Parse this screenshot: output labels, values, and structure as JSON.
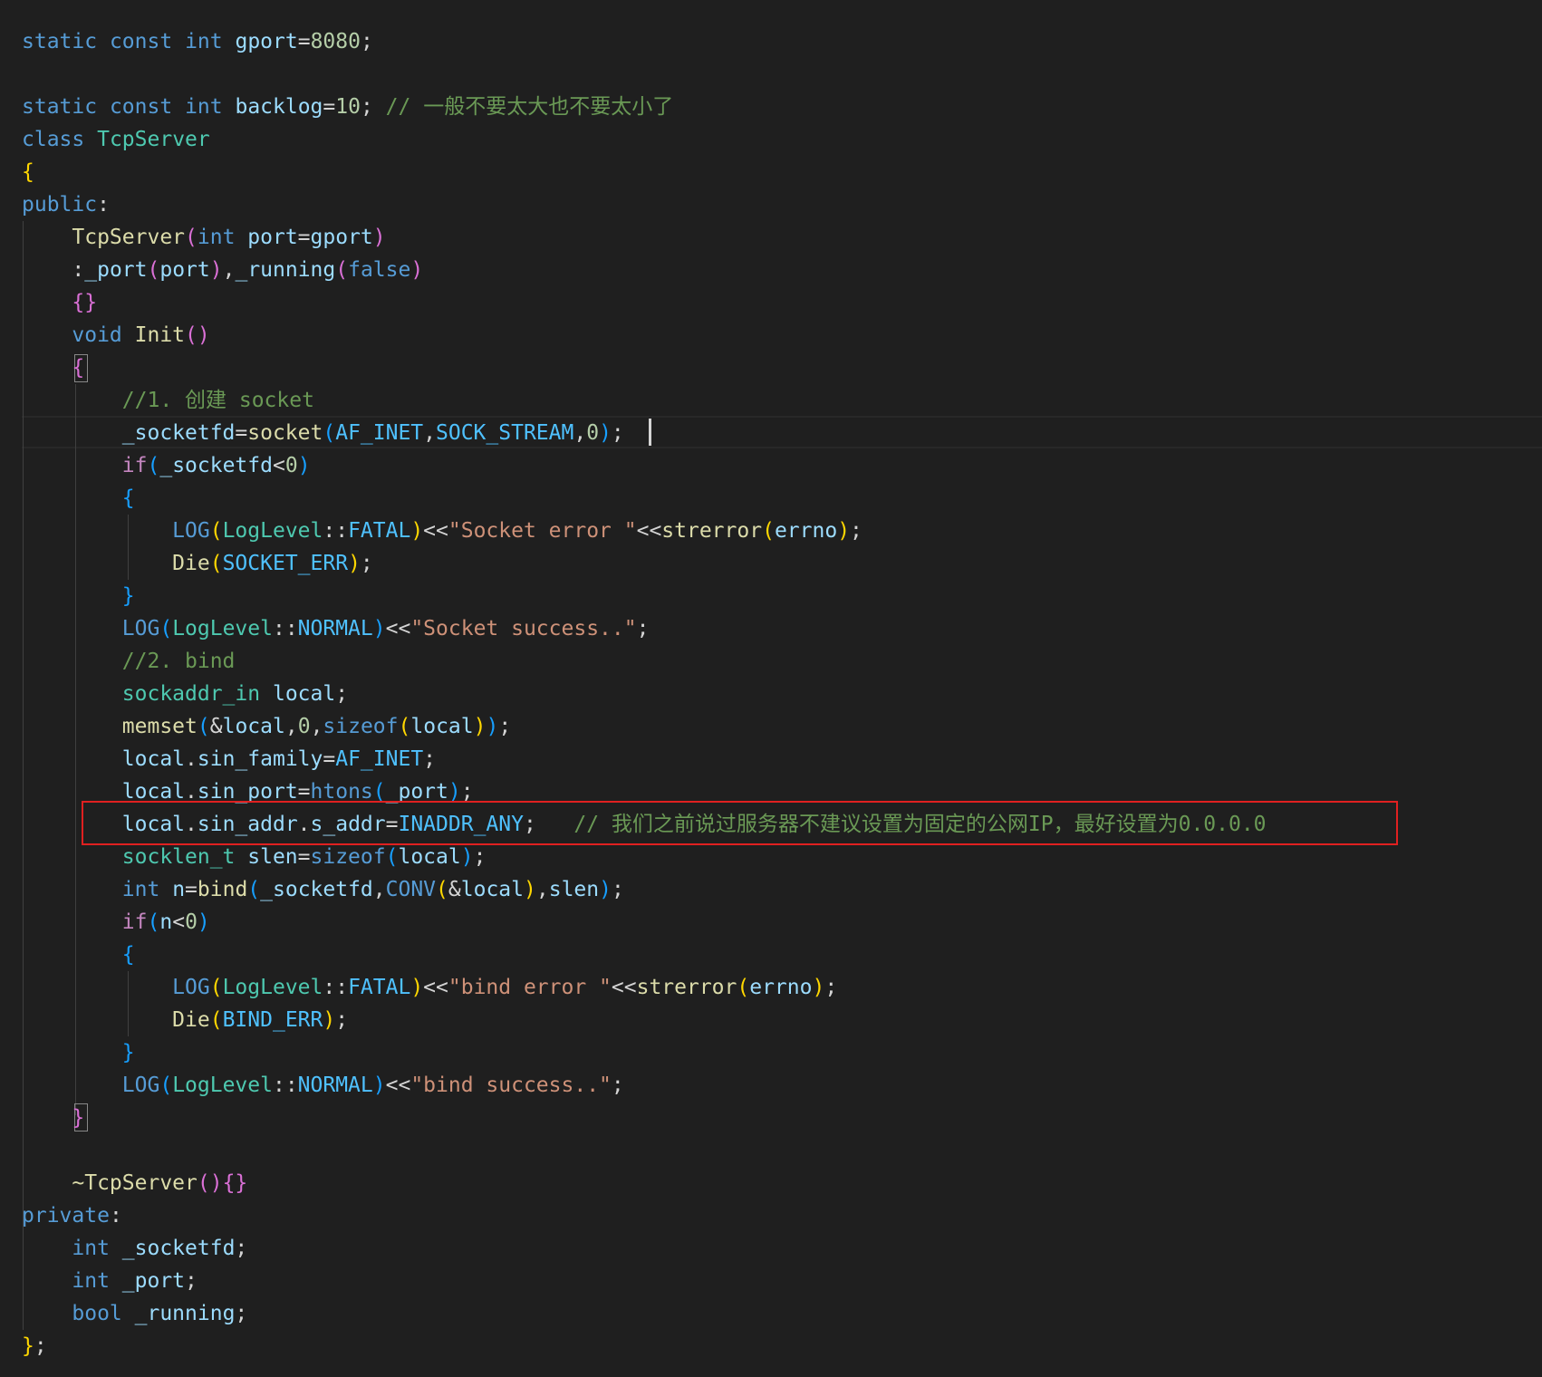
{
  "editor": {
    "theme": "dark",
    "colors": {
      "background": "#1f1f1f",
      "highlight_box": "#e02020",
      "keyword": "#569cd6",
      "control": "#c586c0",
      "type": "#4ec9b0",
      "function": "#dcdcaa",
      "variable": "#9cdcfe",
      "number": "#b5cea8",
      "string": "#ce9178",
      "comment": "#6a9955",
      "constant": "#4fc1ff"
    },
    "lines": [
      [
        {
          "t": "static",
          "c": "kw"
        },
        {
          "t": " "
        },
        {
          "t": "const",
          "c": "kw"
        },
        {
          "t": " "
        },
        {
          "t": "int",
          "c": "kw"
        },
        {
          "t": " "
        },
        {
          "t": "gport",
          "c": "var"
        },
        {
          "t": "="
        },
        {
          "t": "8080",
          "c": "num"
        },
        {
          "t": ";"
        }
      ],
      [],
      [
        {
          "t": "static",
          "c": "kw"
        },
        {
          "t": " "
        },
        {
          "t": "const",
          "c": "kw"
        },
        {
          "t": " "
        },
        {
          "t": "int",
          "c": "kw"
        },
        {
          "t": " "
        },
        {
          "t": "backlog",
          "c": "var"
        },
        {
          "t": "="
        },
        {
          "t": "10",
          "c": "num"
        },
        {
          "t": "; "
        },
        {
          "t": "// 一般不要太大也不要太小了",
          "c": "cmt"
        }
      ],
      [
        {
          "t": "class",
          "c": "kw"
        },
        {
          "t": " "
        },
        {
          "t": "TcpServer",
          "c": "type"
        }
      ],
      [
        {
          "t": "{",
          "c": "b1"
        }
      ],
      [
        {
          "t": "public",
          "c": "kw"
        },
        {
          "t": ":"
        }
      ],
      [
        {
          "t": "    "
        },
        {
          "t": "TcpServer",
          "c": "fn"
        },
        {
          "t": "(",
          "c": "b2"
        },
        {
          "t": "int",
          "c": "kw"
        },
        {
          "t": " "
        },
        {
          "t": "port",
          "c": "var"
        },
        {
          "t": "="
        },
        {
          "t": "gport",
          "c": "var"
        },
        {
          "t": ")",
          "c": "b2"
        }
      ],
      [
        {
          "t": "    "
        },
        {
          "t": ":"
        },
        {
          "t": "_port",
          "c": "var"
        },
        {
          "t": "(",
          "c": "b2"
        },
        {
          "t": "port",
          "c": "var"
        },
        {
          "t": ")",
          "c": "b2"
        },
        {
          "t": ","
        },
        {
          "t": "_running",
          "c": "var"
        },
        {
          "t": "(",
          "c": "b2"
        },
        {
          "t": "false",
          "c": "kw"
        },
        {
          "t": ")",
          "c": "b2"
        }
      ],
      [
        {
          "t": "    "
        },
        {
          "t": "{}",
          "c": "b2"
        }
      ],
      [
        {
          "t": "    "
        },
        {
          "t": "void",
          "c": "kw"
        },
        {
          "t": " "
        },
        {
          "t": "Init",
          "c": "fn"
        },
        {
          "t": "()",
          "c": "b2"
        }
      ],
      [
        {
          "t": "    "
        },
        {
          "t": "{",
          "c": "b2"
        }
      ],
      [
        {
          "t": "        "
        },
        {
          "t": "//1. 创建 socket",
          "c": "cmt"
        }
      ],
      [
        {
          "t": "        "
        },
        {
          "t": "_socketfd",
          "c": "var"
        },
        {
          "t": "="
        },
        {
          "t": "socket",
          "c": "fn"
        },
        {
          "t": "(",
          "c": "b3"
        },
        {
          "t": "AF_INET",
          "c": "con"
        },
        {
          "t": ","
        },
        {
          "t": "SOCK_STREAM",
          "c": "con"
        },
        {
          "t": ","
        },
        {
          "t": "0",
          "c": "num"
        },
        {
          "t": ")",
          "c": "b3"
        },
        {
          "t": ";"
        }
      ],
      [
        {
          "t": "        "
        },
        {
          "t": "if",
          "c": "ctl"
        },
        {
          "t": "(",
          "c": "b3"
        },
        {
          "t": "_socketfd",
          "c": "var"
        },
        {
          "t": "<"
        },
        {
          "t": "0",
          "c": "num"
        },
        {
          "t": ")",
          "c": "b3"
        }
      ],
      [
        {
          "t": "        "
        },
        {
          "t": "{",
          "c": "b3"
        }
      ],
      [
        {
          "t": "            "
        },
        {
          "t": "LOG",
          "c": "kw"
        },
        {
          "t": "(",
          "c": "b1"
        },
        {
          "t": "LogLevel",
          "c": "type"
        },
        {
          "t": "::"
        },
        {
          "t": "FATAL",
          "c": "con"
        },
        {
          "t": ")",
          "c": "b1"
        },
        {
          "t": "<<"
        },
        {
          "t": "\"Socket error \"",
          "c": "str"
        },
        {
          "t": "<<"
        },
        {
          "t": "strerror",
          "c": "fn"
        },
        {
          "t": "(",
          "c": "b1"
        },
        {
          "t": "errno",
          "c": "var"
        },
        {
          "t": ")",
          "c": "b1"
        },
        {
          "t": ";"
        }
      ],
      [
        {
          "t": "            "
        },
        {
          "t": "Die",
          "c": "fn"
        },
        {
          "t": "(",
          "c": "b1"
        },
        {
          "t": "SOCKET_ERR",
          "c": "con"
        },
        {
          "t": ")",
          "c": "b1"
        },
        {
          "t": ";"
        }
      ],
      [
        {
          "t": "        "
        },
        {
          "t": "}",
          "c": "b3"
        }
      ],
      [
        {
          "t": "        "
        },
        {
          "t": "LOG",
          "c": "kw"
        },
        {
          "t": "(",
          "c": "b3"
        },
        {
          "t": "LogLevel",
          "c": "type"
        },
        {
          "t": "::"
        },
        {
          "t": "NORMAL",
          "c": "con"
        },
        {
          "t": ")",
          "c": "b3"
        },
        {
          "t": "<<"
        },
        {
          "t": "\"Socket success..\"",
          "c": "str"
        },
        {
          "t": ";"
        }
      ],
      [
        {
          "t": "        "
        },
        {
          "t": "//2. bind",
          "c": "cmt"
        }
      ],
      [
        {
          "t": "        "
        },
        {
          "t": "sockaddr_in",
          "c": "type"
        },
        {
          "t": " "
        },
        {
          "t": "local",
          "c": "var"
        },
        {
          "t": ";"
        }
      ],
      [
        {
          "t": "        "
        },
        {
          "t": "memset",
          "c": "fn"
        },
        {
          "t": "(",
          "c": "b3"
        },
        {
          "t": "&"
        },
        {
          "t": "local",
          "c": "var"
        },
        {
          "t": ","
        },
        {
          "t": "0",
          "c": "num"
        },
        {
          "t": ","
        },
        {
          "t": "sizeof",
          "c": "kw"
        },
        {
          "t": "(",
          "c": "b1"
        },
        {
          "t": "local",
          "c": "var"
        },
        {
          "t": ")",
          "c": "b1"
        },
        {
          "t": ")",
          "c": "b3"
        },
        {
          "t": ";"
        }
      ],
      [
        {
          "t": "        "
        },
        {
          "t": "local",
          "c": "var"
        },
        {
          "t": "."
        },
        {
          "t": "sin_family",
          "c": "var"
        },
        {
          "t": "="
        },
        {
          "t": "AF_INET",
          "c": "con"
        },
        {
          "t": ";"
        }
      ],
      [
        {
          "t": "        "
        },
        {
          "t": "local",
          "c": "var"
        },
        {
          "t": "."
        },
        {
          "t": "sin_port",
          "c": "var"
        },
        {
          "t": "="
        },
        {
          "t": "htons",
          "c": "kw"
        },
        {
          "t": "(",
          "c": "b3"
        },
        {
          "t": "_port",
          "c": "var"
        },
        {
          "t": ")",
          "c": "b3"
        },
        {
          "t": ";"
        }
      ],
      [
        {
          "t": "        "
        },
        {
          "t": "local",
          "c": "var"
        },
        {
          "t": "."
        },
        {
          "t": "sin_addr",
          "c": "var"
        },
        {
          "t": "."
        },
        {
          "t": "s_addr",
          "c": "var"
        },
        {
          "t": "="
        },
        {
          "t": "INADDR_ANY",
          "c": "con"
        },
        {
          "t": ";   "
        },
        {
          "t": "// 我们之前说过服务器不建议设置为固定的公网IP，最好设置为0.0.0.0",
          "c": "cmt"
        }
      ],
      [
        {
          "t": "        "
        },
        {
          "t": "socklen_t",
          "c": "type"
        },
        {
          "t": " "
        },
        {
          "t": "slen",
          "c": "var"
        },
        {
          "t": "="
        },
        {
          "t": "sizeof",
          "c": "kw"
        },
        {
          "t": "(",
          "c": "b3"
        },
        {
          "t": "local",
          "c": "var"
        },
        {
          "t": ")",
          "c": "b3"
        },
        {
          "t": ";"
        }
      ],
      [
        {
          "t": "        "
        },
        {
          "t": "int",
          "c": "kw"
        },
        {
          "t": " "
        },
        {
          "t": "n",
          "c": "var"
        },
        {
          "t": "="
        },
        {
          "t": "bind",
          "c": "fn"
        },
        {
          "t": "(",
          "c": "b3"
        },
        {
          "t": "_socketfd",
          "c": "var"
        },
        {
          "t": ","
        },
        {
          "t": "CONV",
          "c": "kw"
        },
        {
          "t": "(",
          "c": "b1"
        },
        {
          "t": "&"
        },
        {
          "t": "local",
          "c": "var"
        },
        {
          "t": ")",
          "c": "b1"
        },
        {
          "t": ","
        },
        {
          "t": "slen",
          "c": "var"
        },
        {
          "t": ")",
          "c": "b3"
        },
        {
          "t": ";"
        }
      ],
      [
        {
          "t": "        "
        },
        {
          "t": "if",
          "c": "ctl"
        },
        {
          "t": "(",
          "c": "b3"
        },
        {
          "t": "n",
          "c": "var"
        },
        {
          "t": "<"
        },
        {
          "t": "0",
          "c": "num"
        },
        {
          "t": ")",
          "c": "b3"
        }
      ],
      [
        {
          "t": "        "
        },
        {
          "t": "{",
          "c": "b3"
        }
      ],
      [
        {
          "t": "            "
        },
        {
          "t": "LOG",
          "c": "kw"
        },
        {
          "t": "(",
          "c": "b1"
        },
        {
          "t": "LogLevel",
          "c": "type"
        },
        {
          "t": "::"
        },
        {
          "t": "FATAL",
          "c": "con"
        },
        {
          "t": ")",
          "c": "b1"
        },
        {
          "t": "<<"
        },
        {
          "t": "\"bind error \"",
          "c": "str"
        },
        {
          "t": "<<"
        },
        {
          "t": "strerror",
          "c": "fn"
        },
        {
          "t": "(",
          "c": "b1"
        },
        {
          "t": "errno",
          "c": "var"
        },
        {
          "t": ")",
          "c": "b1"
        },
        {
          "t": ";"
        }
      ],
      [
        {
          "t": "            "
        },
        {
          "t": "Die",
          "c": "fn"
        },
        {
          "t": "(",
          "c": "b1"
        },
        {
          "t": "BIND_ERR",
          "c": "con"
        },
        {
          "t": ")",
          "c": "b1"
        },
        {
          "t": ";"
        }
      ],
      [
        {
          "t": "        "
        },
        {
          "t": "}",
          "c": "b3"
        }
      ],
      [
        {
          "t": "        "
        },
        {
          "t": "LOG",
          "c": "kw"
        },
        {
          "t": "(",
          "c": "b3"
        },
        {
          "t": "LogLevel",
          "c": "type"
        },
        {
          "t": "::"
        },
        {
          "t": "NORMAL",
          "c": "con"
        },
        {
          "t": ")",
          "c": "b3"
        },
        {
          "t": "<<"
        },
        {
          "t": "\"bind success..\"",
          "c": "str"
        },
        {
          "t": ";"
        }
      ],
      [
        {
          "t": "    "
        },
        {
          "t": "}",
          "c": "b2"
        }
      ],
      [],
      [
        {
          "t": "    "
        },
        {
          "t": "~TcpServer",
          "c": "fn"
        },
        {
          "t": "(){}",
          "c": "b2"
        }
      ],
      [
        {
          "t": "private",
          "c": "kw"
        },
        {
          "t": ":"
        }
      ],
      [
        {
          "t": "    "
        },
        {
          "t": "int",
          "c": "kw"
        },
        {
          "t": " "
        },
        {
          "t": "_socketfd",
          "c": "var"
        },
        {
          "t": ";"
        }
      ],
      [
        {
          "t": "    "
        },
        {
          "t": "int",
          "c": "kw"
        },
        {
          "t": " "
        },
        {
          "t": "_port",
          "c": "var"
        },
        {
          "t": ";"
        }
      ],
      [
        {
          "t": "    "
        },
        {
          "t": "bool",
          "c": "kw"
        },
        {
          "t": " "
        },
        {
          "t": "_running",
          "c": "var"
        },
        {
          "t": ";"
        }
      ],
      [
        {
          "t": "}",
          "c": "b1"
        },
        {
          "t": ";"
        }
      ]
    ]
  }
}
